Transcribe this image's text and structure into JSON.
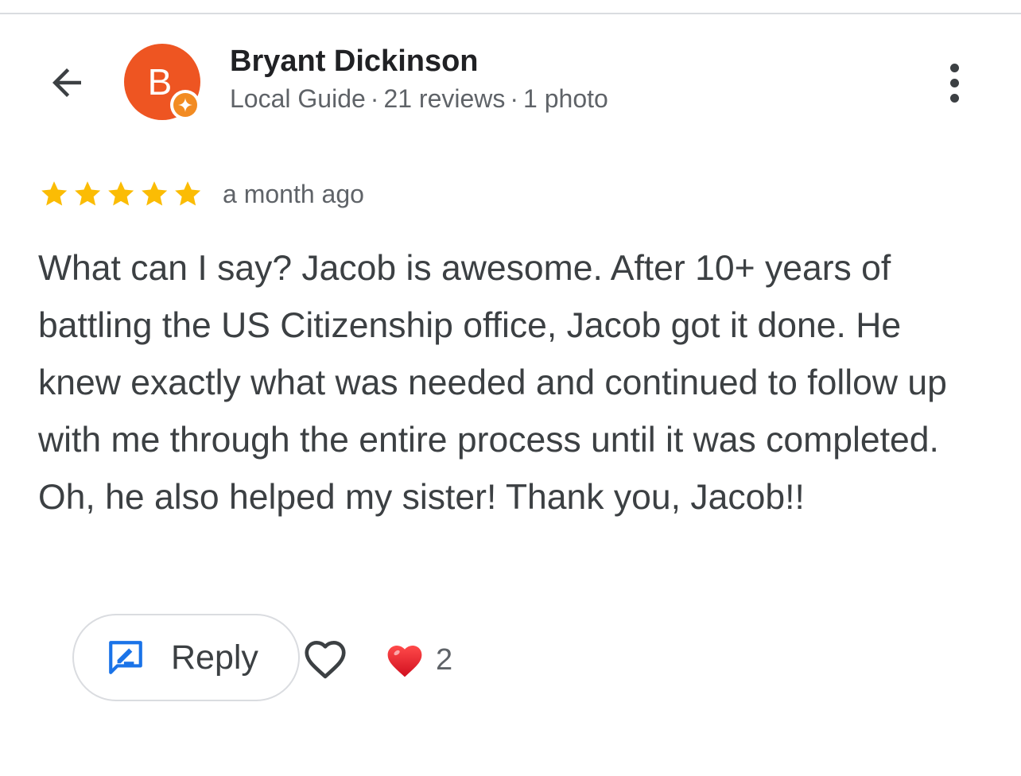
{
  "colors": {
    "avatar": "#ee5522",
    "badge": "#f28b22",
    "star": "#fbbc04",
    "reply_icon": "#1a73e8",
    "heart_filled": "#e11d2a",
    "text_primary": "#202124",
    "text_secondary": "#5f6368"
  },
  "header": {
    "back_icon": "arrow-back-icon",
    "more_icon": "more-vertical-icon"
  },
  "reviewer": {
    "initial": "B",
    "name": "Bryant Dickinson",
    "badge_icon": "local-guide-star-icon",
    "level": "Local Guide",
    "reviews": "21 reviews",
    "photos": "1 photo",
    "separator": "·"
  },
  "review": {
    "rating": 5,
    "max_rating": 5,
    "time": "a month ago",
    "text": "What can I say? Jacob is awesome. After 10+ years of battling the US Citizenship office, Jacob got it done. He knew exactly what was needed and continued to follow up with me through the entire process until it was completed. Oh, he also helped my sister! Thank you, Jacob!!"
  },
  "actions": {
    "reply_label": "Reply",
    "reply_icon": "reply-edit-icon",
    "like_icon": "heart-outline-icon",
    "reaction_icon": "heart-filled-icon",
    "reaction_count": "2"
  }
}
